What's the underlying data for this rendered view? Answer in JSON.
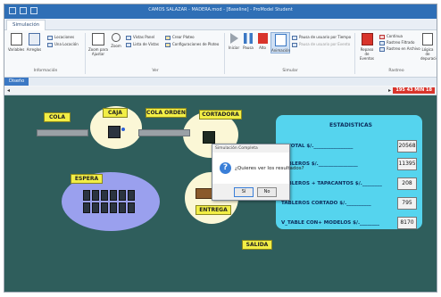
{
  "window": {
    "title": "CAMOS SALAZAR - MADERA.mod - [Baseline] - ProModel Student"
  },
  "ribbon": {
    "tab": "Simulación",
    "group_informacion": {
      "label": "Información",
      "variables": "Variables",
      "arreglos": "Arreglos",
      "locaciones": "Locaciones",
      "una_locacion": "Una Locación"
    },
    "group_ver": {
      "label": "Ver",
      "zoom_ajustar": "Zoom para Ajustar",
      "zoom": "Zoom",
      "vistas_panel": "Vistas Panel",
      "lista_vistas": "Lista de Vistas",
      "crear_ploteo": "Crear Ploteo",
      "config_ploteo": "Configuraciones de Ploteo"
    },
    "group_simular": {
      "label": "Simular",
      "iniciar": "Iniciar",
      "pausa": "Pausa",
      "alto": "Alto",
      "animacion": "Animación",
      "pausa_tiempo": "Pausa de usuario por Tiempo",
      "pausa_evento": "Pausa de usuario por Evento"
    },
    "group_rastreo": {
      "label": "Rastreo",
      "repaso_eventos": "Repaso de Eventos",
      "continua": "Continua",
      "rastreo_filtrado": "Rastreo Filtrado",
      "rastreo_archivo": "Rastreo en Archivo",
      "logica_depuracion": "Lógica de depuración"
    }
  },
  "document_tab": "Diseño",
  "clock": "195 43 MIN 18",
  "model": {
    "labels": {
      "cola": "COLA",
      "caja": "CAJA",
      "cola_orden": "COLA ORDEN",
      "cortadora": "CORTADORA",
      "espera": "ESPERA",
      "entrega": "ENTREGA",
      "salida": "SALIDA"
    },
    "stats": {
      "title": "ESTADISTICAS",
      "rows": [
        {
          "label": "V_TOTAL $/.________________",
          "value": "20568"
        },
        {
          "label": "TABLEROS  $/.________________",
          "value": "11395"
        },
        {
          "label": "TABLEROS + TAPACANTOS $/.________",
          "value": "208"
        },
        {
          "label": "TABLEROS  CORTADO $/.__________",
          "value": "795"
        },
        {
          "label": "V_TABLE CON+ MODELOS $/.________",
          "value": "8170"
        }
      ]
    }
  },
  "dialog": {
    "title": "Simulación Completa",
    "message": "¿Quieres ver los resultados?",
    "yes": "Sí",
    "no": "No"
  },
  "colors": {
    "canvas": "#2f5e5c",
    "label_yellow": "#f2ee45",
    "stats_panel": "#55d4ee",
    "ellipse": "#fbf7d6",
    "espera_ellipse": "#9aa0ee",
    "clock": "#d9342b",
    "titlebar": "#2f6fb6"
  }
}
